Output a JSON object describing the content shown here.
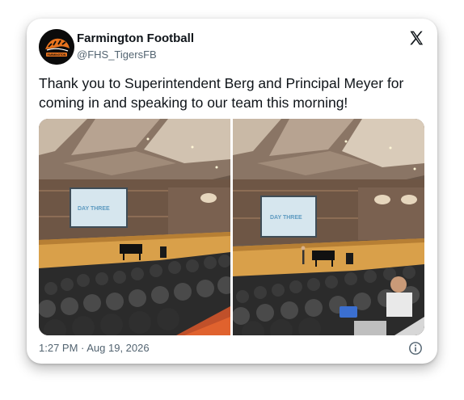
{
  "account": {
    "display_name": "Farmington Football",
    "handle": "@FHS_TigersFB",
    "avatar_icon": "tiger-logo-icon",
    "avatar_text": "FARMINGTON"
  },
  "header": {
    "platform_icon": "x-logo-icon"
  },
  "tweet": {
    "text": "Thank you to Superintendent Berg and Principal Meyer for coming in and speaking to our team this morning!",
    "timestamp": "1:27 PM · Aug 19, 2026"
  },
  "media": {
    "photos": [
      {
        "screen_text": "DAY THREE"
      },
      {
        "screen_text": "DAY THREE"
      }
    ]
  },
  "footer": {
    "info_icon": "info-icon"
  },
  "colors": {
    "text_primary": "#0f1419",
    "text_secondary": "#536471",
    "screen_blue": "#7fb6cf",
    "stage_floor": "#d9a04a"
  }
}
